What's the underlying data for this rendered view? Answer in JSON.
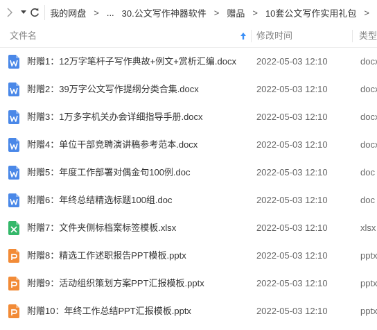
{
  "toolbar": {
    "breadcrumb": [
      "我的网盘",
      "...",
      "30.公文写作神器软件",
      "赠品",
      "10套公文写作实用礼包"
    ],
    "separator": ">"
  },
  "header": {
    "col_name": "文件名",
    "col_date": "修改时间",
    "col_type": "类型",
    "sort_direction": "ascending"
  },
  "colors": {
    "word": "#4a88e8",
    "excel": "#34b86a",
    "ppt": "#f28b37",
    "sort_arrow": "#3b8ff7"
  },
  "files": [
    {
      "name": "附赠1：12万字笔杆子写作典故+例文+赏析汇编.docx",
      "date": "2022-05-03 12:10",
      "type": "docx",
      "icon": "word-icon"
    },
    {
      "name": "附赠2：39万字公文写作提纲分类合集.docx",
      "date": "2022-05-03 12:10",
      "type": "docx",
      "icon": "word-icon"
    },
    {
      "name": "附赠3：1万多字机关办会详细指导手册.docx",
      "date": "2022-05-03 12:10",
      "type": "docx",
      "icon": "word-icon"
    },
    {
      "name": "附赠4：单位干部竞聘演讲稿参考范本.docx",
      "date": "2022-05-03 12:10",
      "type": "docx",
      "icon": "word-icon"
    },
    {
      "name": "附赠5：年度工作部署对偶金句100例.doc",
      "date": "2022-05-03 12:10",
      "type": "doc",
      "icon": "word-icon"
    },
    {
      "name": "附赠6：年终总结精选标题100组.doc",
      "date": "2022-05-03 12:10",
      "type": "doc",
      "icon": "word-icon"
    },
    {
      "name": "附赠7：文件夹侧标档案标签模板.xlsx",
      "date": "2022-05-03 12:10",
      "type": "xlsx",
      "icon": "excel-icon"
    },
    {
      "name": "附赠8：精选工作述职报告PPT模板.pptx",
      "date": "2022-05-03 12:10",
      "type": "pptx",
      "icon": "ppt-icon"
    },
    {
      "name": "附赠9：活动组织策划方案PPT汇报模板.pptx",
      "date": "2022-05-03 12:10",
      "type": "pptx",
      "icon": "ppt-icon"
    },
    {
      "name": "附赠10：年终工作总结PPT汇报模板.pptx",
      "date": "2022-05-03 12:10",
      "type": "pptx",
      "icon": "ppt-icon"
    }
  ]
}
